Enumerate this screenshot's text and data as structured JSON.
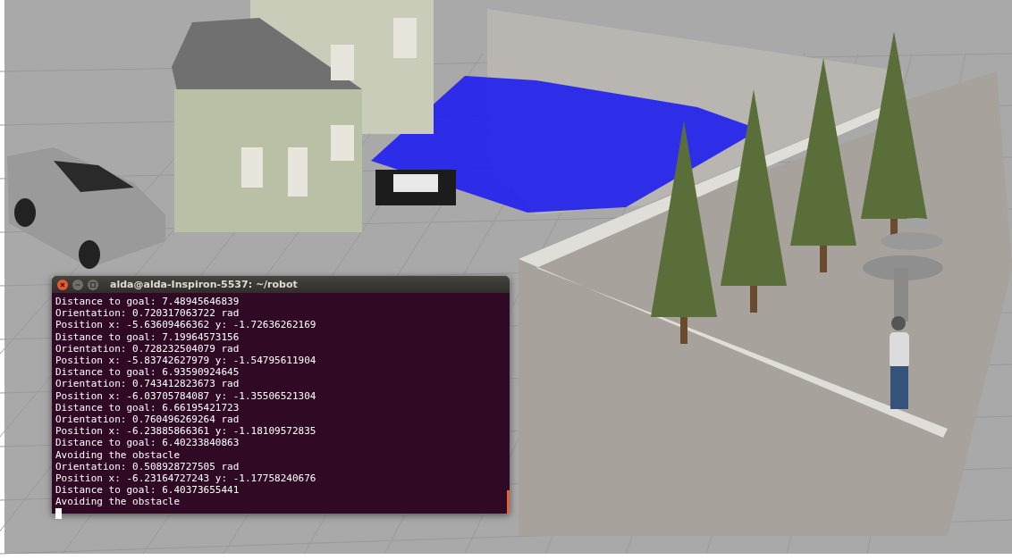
{
  "terminal": {
    "title": "alda@alda-Inspiron-5537: ~/robot",
    "lines": [
      "Distance to goal: 7.48945646839",
      "Orientation: 0.720317063722 rad",
      "Position x: -5.63609466362 y: -1.72636262169",
      "Distance to goal: 7.19964573156",
      "Orientation: 0.728232504079 rad",
      "Position x: -5.83742627979 y: -1.54795611904",
      "Distance to goal: 6.93590924645",
      "Orientation: 0.743412823673 rad",
      "Position x: -6.03705784087 y: -1.35506521304",
      "Distance to goal: 6.66195421723",
      "Orientation: 0.760496269264 rad",
      "Position x: -6.23885866361 y: -1.18109572835",
      "Distance to goal: 6.40233840863",
      "Avoiding the obstacle",
      "Orientation: 0.508928727505 rad",
      "Position x: -6.23164727243 y: -1.17758240676",
      "Distance to goal: 6.40373655441",
      "Avoiding the obstacle"
    ],
    "cursor": true
  }
}
